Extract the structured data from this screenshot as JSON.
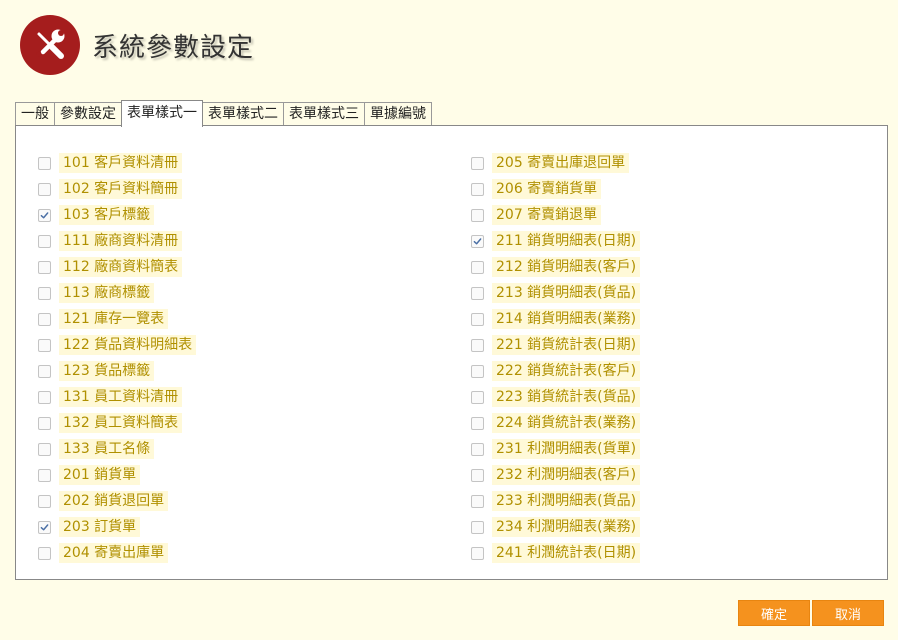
{
  "title": "系統參數設定",
  "tabs": [
    {
      "label": "一般",
      "active": false
    },
    {
      "label": "參數設定",
      "active": false
    },
    {
      "label": "表單樣式一",
      "active": true
    },
    {
      "label": "表單樣式二",
      "active": false
    },
    {
      "label": "表單樣式三",
      "active": false
    },
    {
      "label": "單據編號",
      "active": false
    }
  ],
  "left_items": [
    {
      "label": "101 客戶資料清冊",
      "checked": false
    },
    {
      "label": "102 客戶資料簡冊",
      "checked": false
    },
    {
      "label": "103 客戶標籤",
      "checked": true
    },
    {
      "label": "111 廠商資料清冊",
      "checked": false
    },
    {
      "label": "112 廠商資料簡表",
      "checked": false
    },
    {
      "label": "113 廠商標籤",
      "checked": false
    },
    {
      "label": "121 庫存一覽表",
      "checked": false
    },
    {
      "label": "122 貨品資料明細表",
      "checked": false
    },
    {
      "label": "123 貨品標籤",
      "checked": false
    },
    {
      "label": "131 員工資料清冊",
      "checked": false
    },
    {
      "label": "132 員工資料簡表",
      "checked": false
    },
    {
      "label": "133 員工名條",
      "checked": false
    },
    {
      "label": "201 銷貨單",
      "checked": false
    },
    {
      "label": "202 銷貨退回單",
      "checked": false
    },
    {
      "label": "203 訂貨單",
      "checked": true
    },
    {
      "label": "204 寄賣出庫單",
      "checked": false
    }
  ],
  "right_items": [
    {
      "label": "205 寄賣出庫退回單",
      "checked": false
    },
    {
      "label": "206 寄賣銷貨單",
      "checked": false
    },
    {
      "label": "207 寄賣銷退單",
      "checked": false
    },
    {
      "label": "211 銷貨明細表(日期)",
      "checked": true
    },
    {
      "label": "212 銷貨明細表(客戶)",
      "checked": false
    },
    {
      "label": "213 銷貨明細表(貨品)",
      "checked": false
    },
    {
      "label": "214 銷貨明細表(業務)",
      "checked": false
    },
    {
      "label": "221 銷貨統計表(日期)",
      "checked": false
    },
    {
      "label": "222 銷貨統計表(客戶)",
      "checked": false
    },
    {
      "label": "223 銷貨統計表(貨品)",
      "checked": false
    },
    {
      "label": "224 銷貨統計表(業務)",
      "checked": false
    },
    {
      "label": "231 利潤明細表(貨單)",
      "checked": false
    },
    {
      "label": "232 利潤明細表(客戶)",
      "checked": false
    },
    {
      "label": "233 利潤明細表(貨品)",
      "checked": false
    },
    {
      "label": "234 利潤明細表(業務)",
      "checked": false
    },
    {
      "label": "241 利潤統計表(日期)",
      "checked": false
    }
  ],
  "buttons": {
    "ok": "確定",
    "cancel": "取消"
  },
  "icons": {
    "logo": "tools-icon",
    "check": "checkmark-icon"
  },
  "colors": {
    "logo_bg": "#a51d1d",
    "button": "#f5921e",
    "label_text": "#b09000",
    "label_bg": "#fff9d8",
    "background": "#fffde8"
  }
}
